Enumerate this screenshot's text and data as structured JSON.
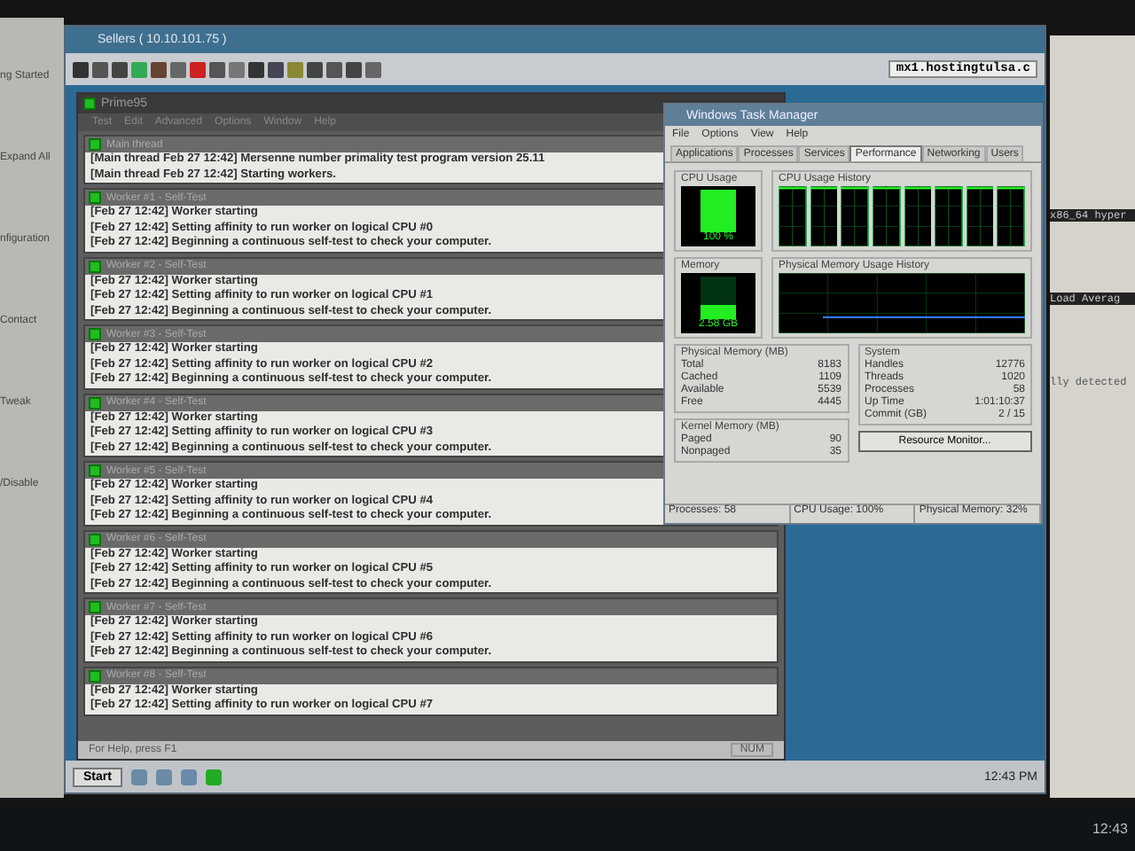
{
  "host_sidebar": {
    "items": [
      "ng Started",
      "Expand All",
      "nfiguration",
      "Contact",
      "Tweak",
      "/Disable"
    ]
  },
  "host_page": {
    "lines": [
      "x86_64 hyper",
      "Load Averag",
      "lly detected"
    ]
  },
  "host_taskbar": {
    "clock": "12:43"
  },
  "remote_window": {
    "title": "Sellers ( 10.10.101.75 )",
    "host": "mx1.hostingtulsa.c"
  },
  "prime95": {
    "title": "Prime95",
    "menu": [
      "Test",
      "Edit",
      "Advanced",
      "Options",
      "Window",
      "Help"
    ],
    "panels": [
      {
        "title": "Main thread",
        "lines": [
          "[Main thread Feb 27 12:42] Mersenne number primality test program version 25.11",
          "[Main thread Feb 27 12:42] Starting workers."
        ]
      },
      {
        "title": "Worker #1 - Self-Test",
        "lines": [
          "[Feb 27 12:42] Worker starting",
          "[Feb 27 12:42] Setting affinity to run worker on logical CPU #0",
          "[Feb 27 12:42] Beginning a continuous self-test to check your computer."
        ]
      },
      {
        "title": "Worker #2 - Self-Test",
        "lines": [
          "[Feb 27 12:42] Worker starting",
          "[Feb 27 12:42] Setting affinity to run worker on logical CPU #1",
          "[Feb 27 12:42] Beginning a continuous self-test to check your computer."
        ]
      },
      {
        "title": "Worker #3 - Self-Test",
        "lines": [
          "[Feb 27 12:42] Worker starting",
          "[Feb 27 12:42] Setting affinity to run worker on logical CPU #2",
          "[Feb 27 12:42] Beginning a continuous self-test to check your computer."
        ]
      },
      {
        "title": "Worker #4 - Self-Test",
        "lines": [
          "[Feb 27 12:42] Worker starting",
          "[Feb 27 12:42] Setting affinity to run worker on logical CPU #3",
          "[Feb 27 12:42] Beginning a continuous self-test to check your computer."
        ]
      },
      {
        "title": "Worker #5 - Self-Test",
        "lines": [
          "[Feb 27 12:42] Worker starting",
          "[Feb 27 12:42] Setting affinity to run worker on logical CPU #4",
          "[Feb 27 12:42] Beginning a continuous self-test to check your computer."
        ]
      },
      {
        "title": "Worker #6 - Self-Test",
        "lines": [
          "[Feb 27 12:42] Worker starting",
          "[Feb 27 12:42] Setting affinity to run worker on logical CPU #5",
          "[Feb 27 12:42] Beginning a continuous self-test to check your computer."
        ]
      },
      {
        "title": "Worker #7 - Self-Test",
        "lines": [
          "[Feb 27 12:42] Worker starting",
          "[Feb 27 12:42] Setting affinity to run worker on logical CPU #6",
          "[Feb 27 12:42] Beginning a continuous self-test to check your computer."
        ]
      },
      {
        "title": "Worker #8 - Self-Test",
        "lines": [
          "[Feb 27 12:42] Worker starting",
          "[Feb 27 12:42] Setting affinity to run worker on logical CPU #7"
        ]
      }
    ],
    "status": "For Help, press F1",
    "indicator": "NUM"
  },
  "remote_taskbar": {
    "start": "Start",
    "clock": "12:43 PM"
  },
  "task_manager": {
    "title": "Windows Task Manager",
    "menu": [
      "File",
      "Options",
      "View",
      "Help"
    ],
    "tabs": [
      {
        "label": "Applications",
        "selected": false
      },
      {
        "label": "Processes",
        "selected": false
      },
      {
        "label": "Services",
        "selected": false
      },
      {
        "label": "Performance",
        "selected": true
      },
      {
        "label": "Networking",
        "selected": false
      },
      {
        "label": "Users",
        "selected": false
      }
    ],
    "cpu": {
      "label": "CPU Usage",
      "level": 1.0,
      "reading": "100 %"
    },
    "cpu_history": {
      "label": "CPU Usage History"
    },
    "memory": {
      "label": "Memory",
      "level": 0.32,
      "reading": "2.58 GB"
    },
    "memory_history": {
      "label": "Physical Memory Usage History"
    },
    "physical_memory": {
      "label": "Physical Memory (MB)",
      "rows": [
        {
          "name": "Total",
          "value": "8183"
        },
        {
          "name": "Cached",
          "value": "1109"
        },
        {
          "name": "Available",
          "value": "5539"
        },
        {
          "name": "Free",
          "value": "4445"
        }
      ]
    },
    "kernel_memory": {
      "label": "Kernel Memory (MB)",
      "rows": [
        {
          "name": "Paged",
          "value": "90"
        },
        {
          "name": "Nonpaged",
          "value": "35"
        }
      ]
    },
    "system": {
      "label": "System",
      "rows": [
        {
          "name": "Handles",
          "value": "12776"
        },
        {
          "name": "Threads",
          "value": "1020"
        },
        {
          "name": "Processes",
          "value": "58"
        },
        {
          "name": "Up Time",
          "value": "1:01:10:37"
        },
        {
          "name": "Commit (GB)",
          "value": "2 / 15"
        }
      ]
    },
    "button": "Resource Monitor...",
    "status": [
      "Processes: 58",
      "CPU Usage: 100%",
      "Physical Memory: 32%"
    ]
  }
}
